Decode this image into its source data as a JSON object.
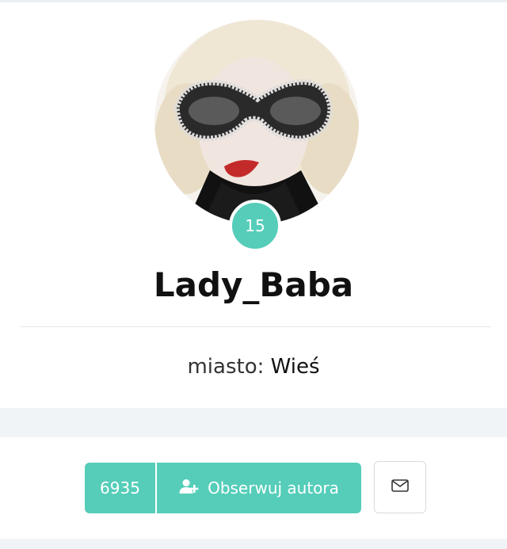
{
  "profile": {
    "level": "15",
    "username": "Lady_Baba",
    "city_label": "miasto:",
    "city_value": "Wieś"
  },
  "actions": {
    "followers_count": "6935",
    "follow_label": "Obserwuj autora",
    "message_icon": "envelope-icon"
  },
  "colors": {
    "accent": "#55cdb9",
    "band": "#f1f4f7"
  }
}
